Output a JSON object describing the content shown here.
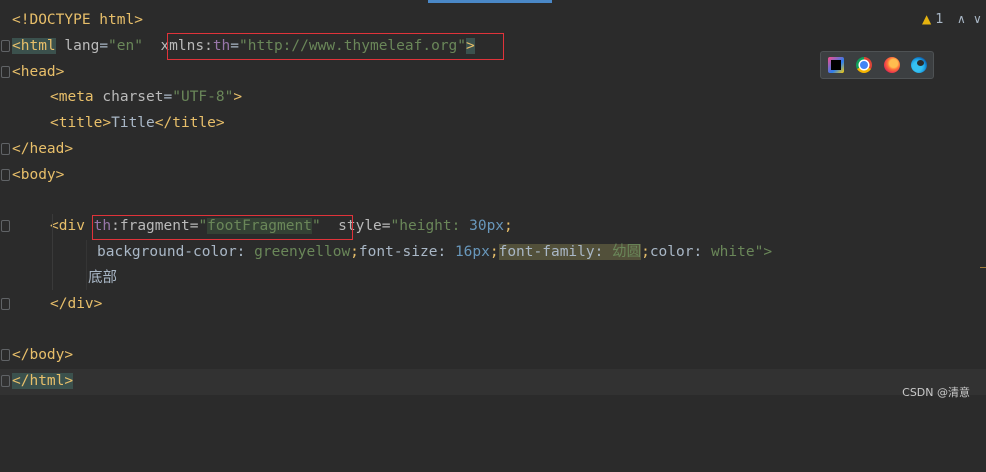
{
  "editor": {
    "lines": [
      {
        "doctype": "<!DOCTYPE html>"
      },
      {
        "html_open": "<html",
        "lang_attr": "lang",
        "lang_val": "\"en\"",
        "xmlns_attr": "xmlns:",
        "xmlns_ns": "th",
        "xmlns_eq": "=",
        "xmlns_val": "\"http://www.thymeleaf.org\"",
        "close": ">"
      },
      {
        "text": "<head>"
      },
      {
        "meta_open": "<meta",
        "charset_attr": "charset",
        "charset_val": "\"UTF-8\"",
        "close": ">"
      },
      {
        "title_open": "<title>",
        "title_text": "Title",
        "title_close": "</title>"
      },
      {
        "text": "</head>"
      },
      {
        "text": "<body>"
      },
      {
        "text": ""
      },
      {
        "div_open": "<div",
        "th": "th",
        "frag_attr": ":fragment=",
        "frag_q1": "\"",
        "frag_val": "footFragment",
        "frag_q2": "\"",
        "style_attr": "style=",
        "style_part1": "\"height: ",
        "style_num1": "30px",
        "style_sep": ";"
      },
      {
        "bg": "background-color: ",
        "bg_val": "greenyellow",
        "sep1": ";",
        "fs": "font-size: ",
        "fs_val": "16px",
        "sep2": ";",
        "ff": "font-family: ",
        "ff_val": "幼圆",
        "sep3": ";",
        "color": "color: ",
        "color_val": "white",
        "end": "\">"
      },
      {
        "text": "底部"
      },
      {
        "text": "</div>"
      },
      {
        "text": ""
      },
      {
        "text": "</body>"
      },
      {
        "text": "</html>"
      }
    ]
  },
  "status": {
    "warning_icon": "warning-triangle-icon",
    "warning_count": "1",
    "up": "∧",
    "down": "∨"
  },
  "browsers": [
    "intellij-icon",
    "chrome-icon",
    "firefox-icon",
    "edge-icon"
  ],
  "watermark": "CSDN @清意",
  "colors": {
    "background": "#2b2b2b",
    "tag": "#e8bf6a",
    "string": "#6a8759",
    "namespace": "#9876aa",
    "number": "#6897bb",
    "annotation_box": "#e0333a"
  }
}
